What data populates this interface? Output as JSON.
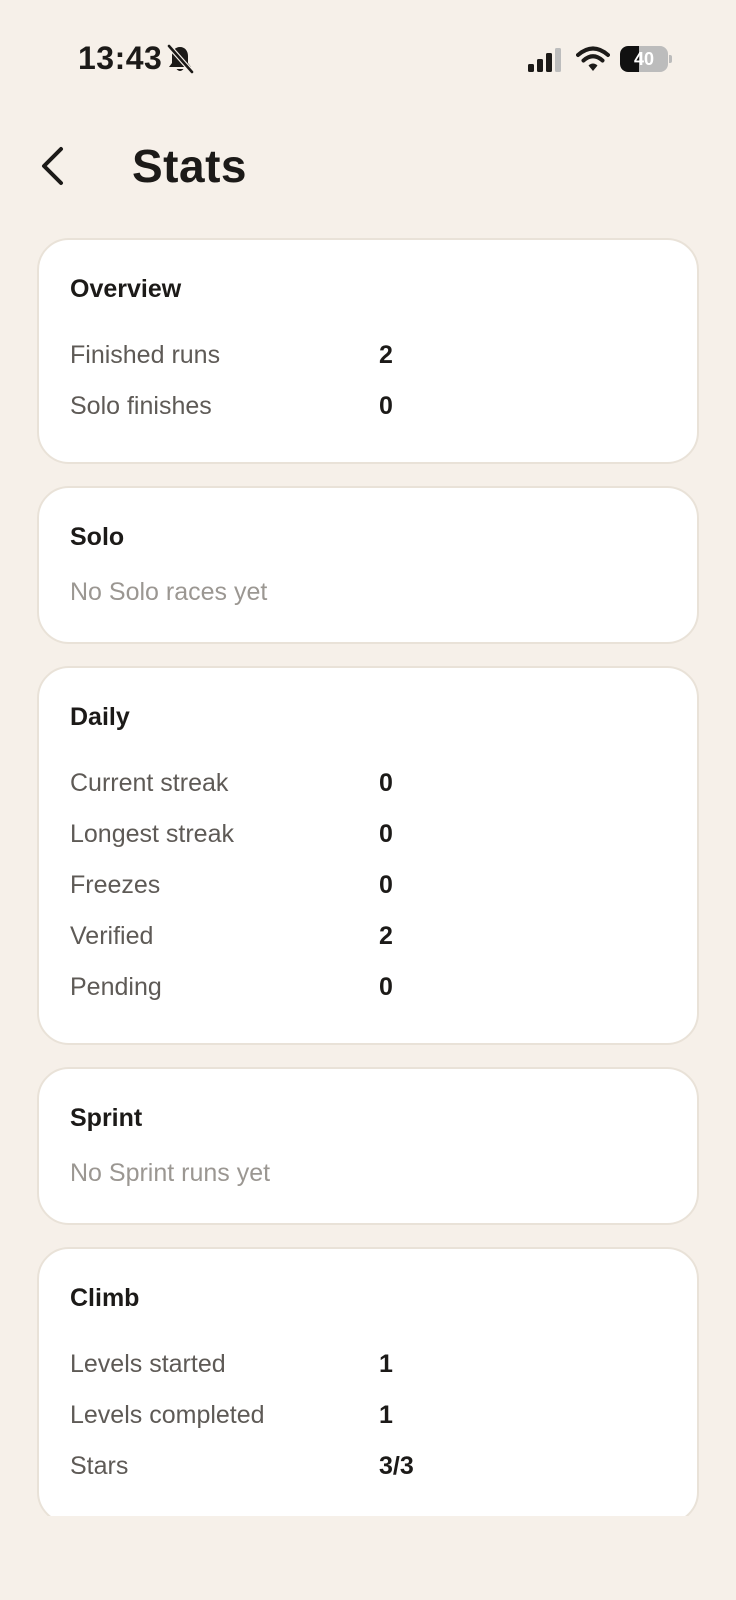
{
  "status_bar": {
    "time": "13:43",
    "battery": "40",
    "battery_level": 0.4
  },
  "header": {
    "title": "Stats"
  },
  "cards": {
    "overview": {
      "title": "Overview",
      "rows": [
        {
          "label": "Finished runs",
          "value": "2"
        },
        {
          "label": "Solo finishes",
          "value": "0"
        }
      ]
    },
    "solo": {
      "title": "Solo",
      "empty": "No Solo races yet"
    },
    "daily": {
      "title": "Daily",
      "rows": [
        {
          "label": "Current streak",
          "value": "0"
        },
        {
          "label": "Longest streak",
          "value": "0"
        },
        {
          "label": "Freezes",
          "value": "0"
        },
        {
          "label": "Verified",
          "value": "2"
        },
        {
          "label": "Pending",
          "value": "0"
        }
      ]
    },
    "sprint": {
      "title": "Sprint",
      "empty": "No Sprint runs yet"
    },
    "climb": {
      "title": "Climb",
      "rows": [
        {
          "label": "Levels started",
          "value": "1"
        },
        {
          "label": "Levels completed",
          "value": "1"
        },
        {
          "label": "Stars",
          "value": "3/3"
        }
      ]
    }
  },
  "colors": {
    "background": "#f6f0e9",
    "card": "#ffffff",
    "card_border": "#e9e2d8",
    "label": "#5e5a56",
    "muted": "#9b9792",
    "text": "#1c1a18"
  },
  "icons": {
    "back": "chevron-left-icon",
    "mute": "bell-slash-icon",
    "signal": "cellular-signal-icon",
    "wifi": "wifi-icon",
    "battery": "battery-icon"
  }
}
